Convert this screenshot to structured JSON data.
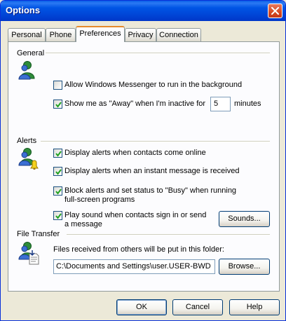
{
  "window": {
    "title": "Options"
  },
  "tabs": [
    {
      "label": "Personal"
    },
    {
      "label": "Phone"
    },
    {
      "label": "Preferences"
    },
    {
      "label": "Privacy"
    },
    {
      "label": "Connection"
    }
  ],
  "active_tab": "Preferences",
  "general": {
    "heading": "General",
    "allow_background": {
      "label": "Allow Windows Messenger to run in the background",
      "checked": false
    },
    "show_away": {
      "label": "Show me as \"Away\" when I'm inactive for",
      "checked": true
    },
    "minutes_value": "5",
    "minutes_label": "minutes"
  },
  "alerts": {
    "heading": "Alerts",
    "online": {
      "label": "Display alerts when contacts come online",
      "checked": true
    },
    "instant_message": {
      "label": "Display alerts when an instant message is received",
      "checked": true
    },
    "block_line1": "Block alerts and set status to \"Busy\" when running",
    "block_line2": "full-screen programs",
    "block_checked": true,
    "sound_line1": "Play sound when contacts sign in or send",
    "sound_line2": "a message",
    "sound_checked": true,
    "sounds_button": "Sounds..."
  },
  "file_transfer": {
    "heading": "File Transfer",
    "description": "Files received from others will be put in this folder:",
    "folder_path": "C:\\Documents and Settings\\user.USER-BWD",
    "browse_button": "Browse..."
  },
  "buttons": {
    "ok": "OK",
    "cancel": "Cancel",
    "help": "Help"
  },
  "colors": {
    "title_bar": "#0055E5",
    "dialog_bg": "#ECE9D8",
    "active_tab_accent": "#E68B2C"
  }
}
